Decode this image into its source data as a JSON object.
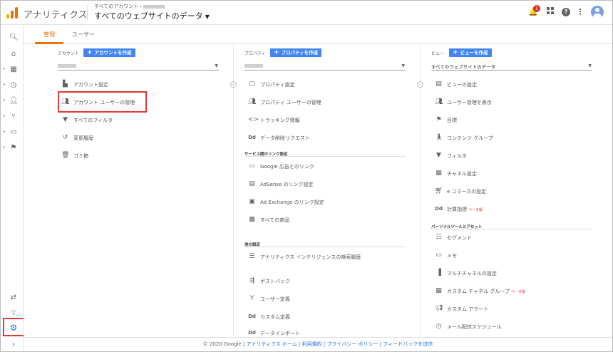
{
  "header": {
    "app_title": "アナリティクス",
    "breadcrumb": "すべてのアカウント ›",
    "view_name": "すべてのウェブサイトのデータ",
    "notification_count": "1"
  },
  "tabs": {
    "admin": "管理",
    "user": "ユーザー"
  },
  "account_col": {
    "head": "アカウント",
    "create": "アカウントを作成",
    "items": [
      {
        "label": "アカウント設定",
        "icon": "building-icon"
      },
      {
        "label": "アカウント ユーザーの管理",
        "icon": "people-icon"
      },
      {
        "label": "すべてのフィルタ",
        "icon": "filter-icon"
      },
      {
        "label": "変更履歴",
        "icon": "history-icon"
      },
      {
        "label": "ゴミ箱",
        "icon": "trash-icon"
      }
    ]
  },
  "property_col": {
    "head": "プロパティ",
    "create": "プロパティを作成",
    "items": [
      {
        "label": "プロパティ設定"
      },
      {
        "label": "プロパティ ユーザーの管理"
      },
      {
        "label": "トラッキング情報"
      },
      {
        "label": "データ削除リクエスト"
      }
    ],
    "section_links": "サービス間のリンク設定",
    "links": [
      {
        "label": "Google 広告とのリンク"
      },
      {
        "label": "AdSense のリンク設定"
      },
      {
        "label": "Ad Exchange のリンク設定"
      },
      {
        "label": "すべての商品"
      }
    ],
    "section_other": "他の設定",
    "other": [
      {
        "label": "アナリティクス インテリジェンスの検索履歴"
      },
      {
        "label": "ポストバック"
      },
      {
        "label": "ユーザー定義"
      },
      {
        "label": "カスタム定義"
      },
      {
        "label": "データインポート"
      }
    ]
  },
  "view_col": {
    "head": "ビュー",
    "create": "ビューを作成",
    "select": "すべてのウェブサイトのデータ",
    "items": [
      {
        "label": "ビューの設定"
      },
      {
        "label": "ユーザー管理を表示"
      },
      {
        "label": "目標"
      },
      {
        "label": "コンテンツ グループ"
      },
      {
        "label": "フィルタ"
      },
      {
        "label": "チャネル設定"
      },
      {
        "label": "e コマースの設定"
      },
      {
        "label": "計算指標",
        "beta": "ベータ版"
      }
    ],
    "section_personal": "パーソナルツールとアセット",
    "personal": [
      {
        "label": "セグメント"
      },
      {
        "label": "メモ"
      },
      {
        "label": "マルチチャネルの設定"
      },
      {
        "label": "カスタム チャネル グループ",
        "beta": "ベータ版"
      },
      {
        "label": "カスタム アラート"
      },
      {
        "label": "メール配信スケジュール"
      }
    ]
  },
  "footer": {
    "copyright": "© 2020 Google |",
    "home": "アナリティクス ホーム",
    "sep1": "|",
    "terms": "利用規約",
    "sep2": "|",
    "privacy": "プライバシー ポリシー",
    "sep3": "|",
    "feedback": "フィードバックを送信"
  },
  "colors": {
    "accent": "#e8710a",
    "button_blue": "#4285f4",
    "highlight_red": "#e53935",
    "link_blue": "#1a73e8"
  }
}
